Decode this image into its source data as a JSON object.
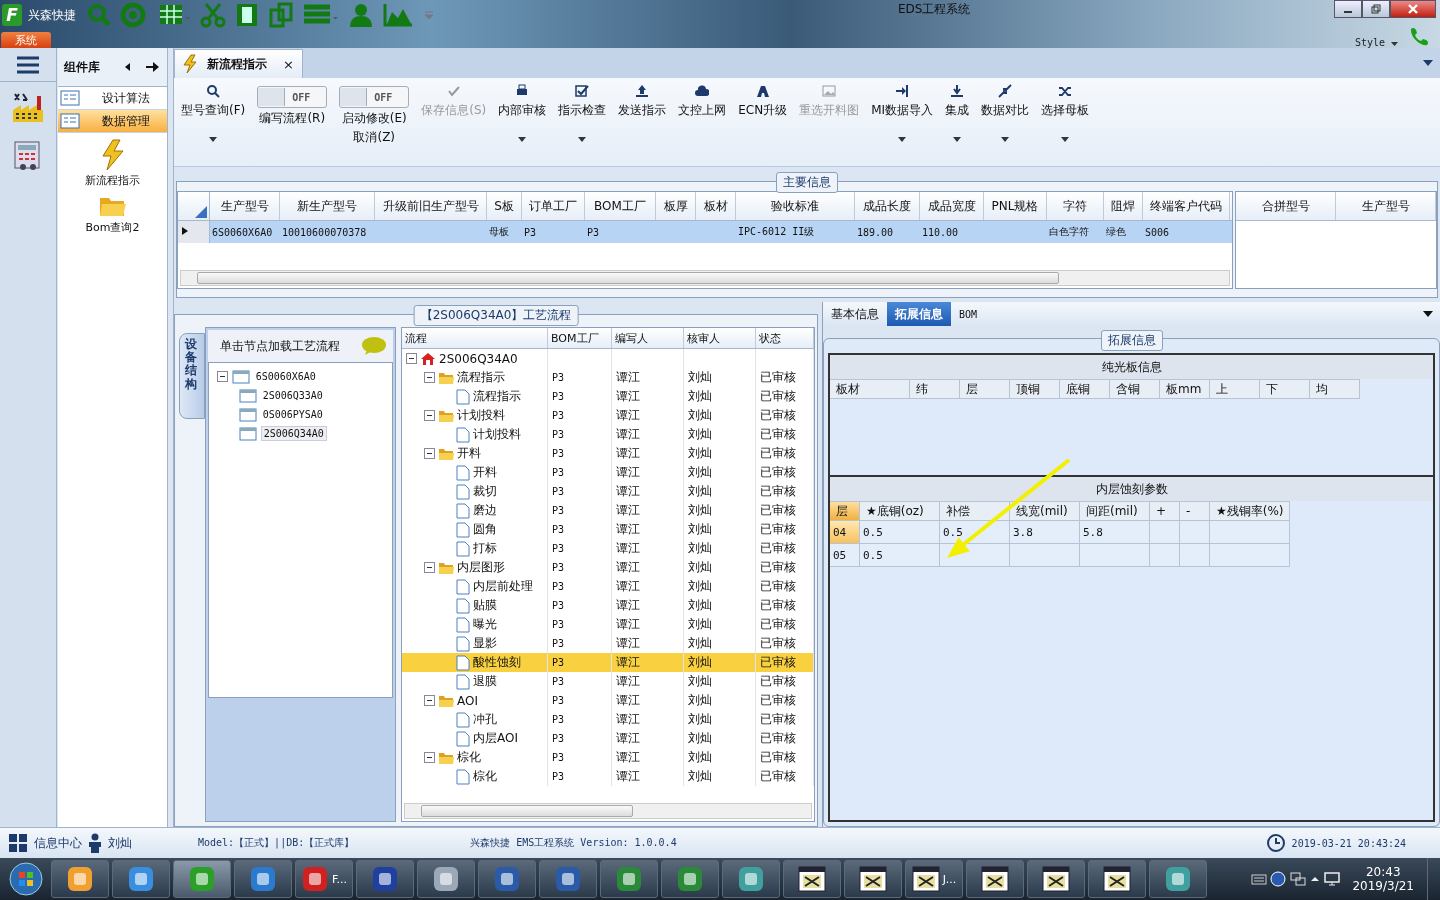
{
  "window": {
    "logo_text": "F",
    "title": "EDS工程系统",
    "app_name": "兴森快捷",
    "menu_tab": "系统",
    "style_label": "Style"
  },
  "sidebar": {
    "title": "组件库",
    "items": [
      {
        "label": "设计算法",
        "selected": false
      },
      {
        "label": "数据管理",
        "selected": true
      }
    ],
    "tools": [
      {
        "label": "新流程指示"
      },
      {
        "label": "Bom查询2"
      }
    ]
  },
  "doc_tab": {
    "label": "新流程指示",
    "close": "×"
  },
  "toolbar": [
    {
      "kind": "button",
      "label": "型号查询(F)",
      "dropdown": true,
      "disabled": false
    },
    {
      "kind": "toggle",
      "label": "编写流程(R)",
      "state_text": "OFF",
      "on": false
    },
    {
      "kind": "toggle",
      "label": "启动修改(E)",
      "label2": "取消(Z)",
      "state_text": "OFF",
      "on": false
    },
    {
      "kind": "button",
      "label": "保存信息(S)",
      "dropdown": false,
      "disabled": true
    },
    {
      "kind": "button",
      "label": "内部审核",
      "dropdown": true,
      "disabled": false
    },
    {
      "kind": "button",
      "label": "指示检查",
      "dropdown": true,
      "disabled": false
    },
    {
      "kind": "button",
      "label": "发送指示",
      "dropdown": false,
      "disabled": false
    },
    {
      "kind": "button",
      "label": "文控上网",
      "dropdown": false,
      "disabled": false
    },
    {
      "kind": "button",
      "label": "ECN升级",
      "dropdown": false,
      "disabled": false
    },
    {
      "kind": "button",
      "label": "重选开料图",
      "dropdown": false,
      "disabled": true
    },
    {
      "kind": "button",
      "label": "MI数据导入",
      "dropdown": true,
      "disabled": false
    },
    {
      "kind": "button",
      "label": "集成",
      "dropdown": true,
      "disabled": false
    },
    {
      "kind": "button",
      "label": "数据对比",
      "dropdown": true,
      "disabled": false
    },
    {
      "kind": "button",
      "label": "选择母板",
      "dropdown": true,
      "disabled": false
    }
  ],
  "main_info": {
    "title": "主要信息",
    "columns": [
      "生产型号",
      "新生产型号",
      "升级前旧生产型号",
      "S板",
      "订单工厂",
      "BOM工厂",
      "板厚",
      "板材",
      "验收标准",
      "成品长度",
      "成品宽度",
      "PNL规格",
      "字符",
      "阻焊",
      "终端客户代码"
    ],
    "rows": [
      {
        "selected": true,
        "cells": [
          "6S0060X6A0",
          "10010600070378",
          null,
          "母板",
          "P3",
          "P3",
          null,
          null,
          "IPC-6012 II级",
          "189.00",
          "110.00",
          null,
          "白色字符",
          "绿色",
          "S006"
        ]
      }
    ],
    "side_columns": [
      "合拼型号",
      "生产型号"
    ]
  },
  "process": {
    "title": "【2S006Q34A0】工艺流程",
    "side_tab": "设备结构",
    "hint": "单击节点加载工艺流程",
    "structure": [
      {
        "name": "6S0060X6A0",
        "expanded": true,
        "selected": false,
        "children": [
          {
            "name": "2S006Q33A0",
            "selected": false
          },
          {
            "name": "0S006PYSA0",
            "selected": false
          },
          {
            "name": "2S006Q34A0",
            "selected": true
          }
        ]
      }
    ],
    "columns": [
      "流程",
      "BOM工厂",
      "编写人",
      "核审人",
      "状态"
    ],
    "flow": [
      {
        "name": "2S006Q34A0",
        "expanded": true,
        "selected": false,
        "children": [
          {
            "name": "流程指示",
            "bom": "P3",
            "writer": "谭江",
            "reviewer": "刘灿",
            "status": "已审核",
            "expanded": true,
            "selected": false,
            "children": [
              {
                "name": "流程指示",
                "bom": "P3",
                "writer": "谭江",
                "reviewer": "刘灿",
                "status": "已审核",
                "selected": false
              }
            ]
          },
          {
            "name": "计划投料",
            "bom": "P3",
            "writer": "谭江",
            "reviewer": "刘灿",
            "status": "已审核",
            "expanded": true,
            "selected": false,
            "children": [
              {
                "name": "计划投料",
                "bom": "P3",
                "writer": "谭江",
                "reviewer": "刘灿",
                "status": "已审核",
                "selected": false
              }
            ]
          },
          {
            "name": "开料",
            "bom": "P3",
            "writer": "谭江",
            "reviewer": "刘灿",
            "status": "已审核",
            "expanded": true,
            "selected": false,
            "children": [
              {
                "name": "开料",
                "bom": "P3",
                "writer": "谭江",
                "reviewer": "刘灿",
                "status": "已审核",
                "selected": false
              },
              {
                "name": "裁切",
                "bom": "P3",
                "writer": "谭江",
                "reviewer": "刘灿",
                "status": "已审核",
                "selected": false
              },
              {
                "name": "磨边",
                "bom": "P3",
                "writer": "谭江",
                "reviewer": "刘灿",
                "status": "已审核",
                "selected": false
              },
              {
                "name": "圆角",
                "bom": "P3",
                "writer": "谭江",
                "reviewer": "刘灿",
                "status": "已审核",
                "selected": false
              },
              {
                "name": "打标",
                "bom": "P3",
                "writer": "谭江",
                "reviewer": "刘灿",
                "status": "已审核",
                "selected": false
              }
            ]
          },
          {
            "name": "内层图形",
            "bom": "P3",
            "writer": "谭江",
            "reviewer": "刘灿",
            "status": "已审核",
            "expanded": true,
            "selected": false,
            "children": [
              {
                "name": "内层前处理",
                "bom": "P3",
                "writer": "谭江",
                "reviewer": "刘灿",
                "status": "已审核",
                "selected": false
              },
              {
                "name": "贴膜",
                "bom": "P3",
                "writer": "谭江",
                "reviewer": "刘灿",
                "status": "已审核",
                "selected": false
              },
              {
                "name": "曝光",
                "bom": "P3",
                "writer": "谭江",
                "reviewer": "刘灿",
                "status": "已审核",
                "selected": false
              },
              {
                "name": "显影",
                "bom": "P3",
                "writer": "谭江",
                "reviewer": "刘灿",
                "status": "已审核",
                "selected": false
              },
              {
                "name": "酸性蚀刻",
                "bom": "P3",
                "writer": "谭江",
                "reviewer": "刘灿",
                "status": "已审核",
                "selected": true
              },
              {
                "name": "退膜",
                "bom": "P3",
                "writer": "谭江",
                "reviewer": "刘灿",
                "status": "已审核",
                "selected": false
              }
            ]
          },
          {
            "name": "AOI",
            "bom": "P3",
            "writer": "谭江",
            "reviewer": "刘灿",
            "status": "已审核",
            "expanded": true,
            "selected": false,
            "children": [
              {
                "name": "冲孔",
                "bom": "P3",
                "writer": "谭江",
                "reviewer": "刘灿",
                "status": "已审核",
                "selected": false
              },
              {
                "name": "内层AOI",
                "bom": "P3",
                "writer": "谭江",
                "reviewer": "刘灿",
                "status": "已审核",
                "selected": false
              }
            ]
          },
          {
            "name": "棕化",
            "bom": "P3",
            "writer": "谭江",
            "reviewer": "刘灿",
            "status": "已审核",
            "expanded": true,
            "selected": false,
            "children": [
              {
                "name": "棕化",
                "bom": "P3",
                "writer": "谭江",
                "reviewer": "刘灿",
                "status": "已审核",
                "selected": false
              }
            ]
          }
        ]
      }
    ]
  },
  "detail": {
    "tabs": [
      {
        "label": "基本信息",
        "selected": false
      },
      {
        "label": "拓展信息",
        "selected": true
      },
      {
        "label": "BOM",
        "selected": false
      }
    ],
    "title": "拓展信息",
    "bare_board": {
      "title": "纯光板信息",
      "columns": [
        "板材",
        "纬",
        "层",
        "顶铜",
        "底铜",
        "含铜",
        "板mm",
        "上",
        "下",
        "均"
      ]
    },
    "etching": {
      "title": "内层蚀刻参数",
      "columns": [
        "层",
        "★底铜(oz)",
        "补偿",
        "线宽(mil)",
        "间距(mil)",
        "+",
        "-",
        "★残铜率(%)"
      ],
      "rows": [
        {
          "selected": true,
          "cells": [
            "04",
            "0.5",
            "0.5",
            "3.8",
            "5.8"
          ]
        },
        {
          "selected": false,
          "cells": [
            "05",
            "0.5"
          ]
        }
      ]
    }
  },
  "status_bar": {
    "info": "信息中心",
    "user": "刘灿",
    "env": "Model:【正式】||DB:【正式库】",
    "version": "兴森快捷 EMS工程系统 Version: 1.0.0.4",
    "datetime": "2019-03-21 20:43:24"
  },
  "taskbar": {
    "items": [
      {
        "kind": "shell"
      },
      {
        "kind": "bird"
      },
      {
        "kind": "app",
        "active": true
      },
      {
        "kind": "browser"
      },
      {
        "kind": "red",
        "label": "F..."
      },
      {
        "kind": "disk"
      },
      {
        "kind": "stack"
      },
      {
        "kind": "word"
      },
      {
        "kind": "word"
      },
      {
        "kind": "excel"
      },
      {
        "kind": "excel"
      },
      {
        "kind": "disc"
      },
      {
        "kind": "window"
      },
      {
        "kind": "window"
      },
      {
        "kind": "window",
        "label": "J..."
      },
      {
        "kind": "window"
      },
      {
        "kind": "window"
      },
      {
        "kind": "window"
      },
      {
        "kind": "disc"
      }
    ],
    "time": "20:43",
    "date": "2019/3/21"
  }
}
